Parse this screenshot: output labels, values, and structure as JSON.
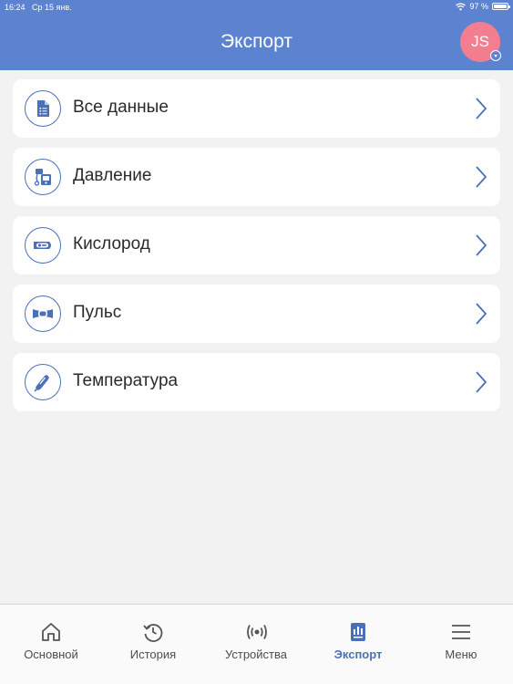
{
  "status_bar": {
    "time": "16:24",
    "date": "Ср 15 янв.",
    "battery": "97 %",
    "battery_level": 0.97
  },
  "header": {
    "title": "Экспорт",
    "avatar_initials": "JS"
  },
  "items": [
    {
      "label": "Все данные",
      "icon": "document-list-icon"
    },
    {
      "label": "Давление",
      "icon": "blood-pressure-monitor-icon"
    },
    {
      "label": "Кислород",
      "icon": "pulse-oximeter-icon"
    },
    {
      "label": "Пульс",
      "icon": "heart-rate-band-icon"
    },
    {
      "label": "Температура",
      "icon": "thermometer-icon"
    }
  ],
  "tabs": [
    {
      "label": "Основной",
      "icon": "home-icon",
      "active": false
    },
    {
      "label": "История",
      "icon": "history-icon",
      "active": false
    },
    {
      "label": "Устройства",
      "icon": "broadcast-icon",
      "active": false
    },
    {
      "label": "Экспорт",
      "icon": "report-icon",
      "active": true
    },
    {
      "label": "Меню",
      "icon": "menu-icon",
      "active": false
    }
  ],
  "colors": {
    "accent": "#5b83d0",
    "icon_stroke": "#4a70b9",
    "avatar": "#f37e8f",
    "background": "#f2f2f2"
  }
}
